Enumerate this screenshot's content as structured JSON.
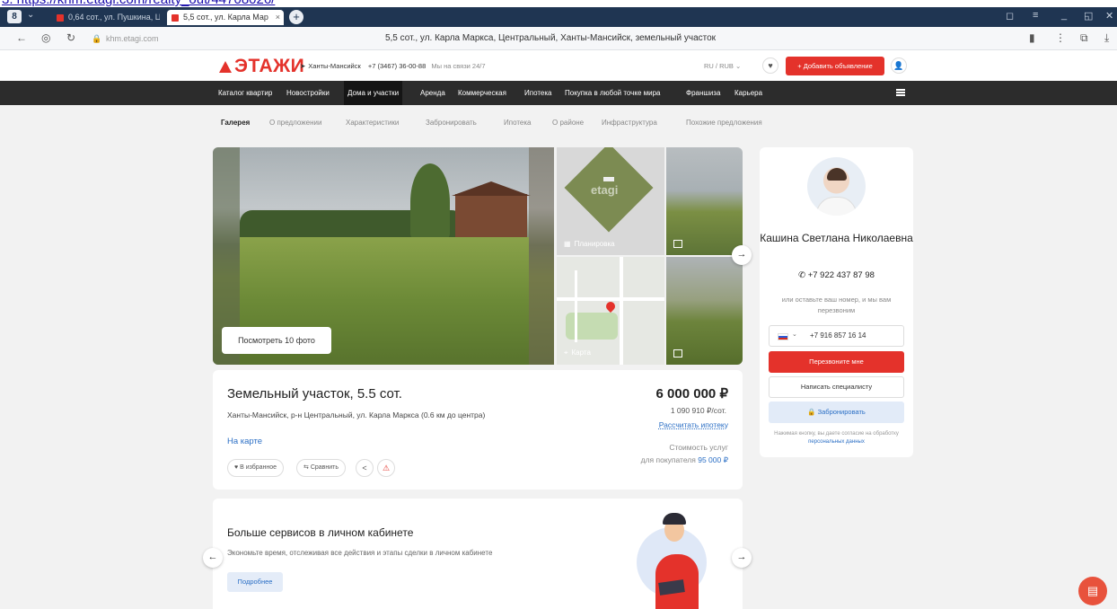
{
  "url_strip": {
    "text": "3. https://khm.etagi.com/realty_out/44708026/"
  },
  "browser": {
    "app_badge": "8",
    "tabs": [
      {
        "label": "0,64 сот., ул. Пушкина, Ц"
      },
      {
        "label": "5,5 сот., ул. Карла Мар"
      }
    ],
    "tab_close": "×",
    "new_tab": "+",
    "host": "khm.etagi.com",
    "page_title": "5,5 сот., ул. Карла Маркса, Центральный, Ханты-Мансийск, земельный участок",
    "nav_back": "←",
    "nav_menu": "⋮"
  },
  "site": {
    "logo_text": "ЭТАЖИ",
    "city": "Ханты-Мансийск",
    "phone": "+7 (3467) 36-00-88",
    "support_note": "Мы на связи 24/7",
    "lang": "RU / RUB",
    "add_listing": "+ Добавить объявление",
    "main_nav": [
      "Каталог квартир",
      "Новостройки",
      "Дома и участки",
      "Аренда",
      "Коммерческая",
      "Ипотека",
      "Покупка в любой точке мира",
      "Франшиза",
      "Карьера"
    ],
    "sub_nav": [
      "Галерея",
      "О предложении",
      "Характеристики",
      "Забронировать",
      "Ипотека",
      "О районе",
      "Инфраструктура",
      "Похожие предложения"
    ]
  },
  "gallery": {
    "photos_button": "Посмотреть 10 фото",
    "plan_caption": "Планировка",
    "plan_watermark": "etagi",
    "map_caption": "Карта",
    "next": "→"
  },
  "listing": {
    "title": "Земельный участок, 5.5 сот.",
    "address": "Ханты-Мансийск, р-н Центральный, ул. Карла Маркса (0.6 км до центра)",
    "on_map": "На карте",
    "actions": {
      "favorite": "♥ В избранное",
      "compare": "Сравнить"
    },
    "price": "6 000 000 ₽",
    "price_per": "1 090 910 ₽/сот.",
    "mortgage_link": "Рассчитать ипотеку",
    "fee_label_1": "Стоимость услуг",
    "fee_label_2": "для покупателя",
    "fee_value": "95 000 ₽"
  },
  "promo": {
    "title": "Больше сервисов в личном кабинете",
    "text": "Экономьте время, отслеживая все действия и этапы сделки в личном кабинете",
    "button": "Подробнее",
    "prev": "←",
    "next": "→"
  },
  "agent": {
    "name": "Кашина Светлана Николаевна",
    "phone": "+7 922 437 87 98",
    "hint": "или оставьте ваш номер, и мы вам перезвоним",
    "input_value": "+7 916 857 16 14",
    "call_button": "Перезвоните мне",
    "write_button": "Написать специалисту",
    "book_button": "Забронировать",
    "consent_text": "Нажимая кнопку, вы даете согласие на обработку",
    "consent_link": "персональных данных"
  },
  "colors": {
    "brand_red": "#e4322b",
    "nav_dark": "#2c2c2c",
    "link_blue": "#2b6fc5"
  }
}
